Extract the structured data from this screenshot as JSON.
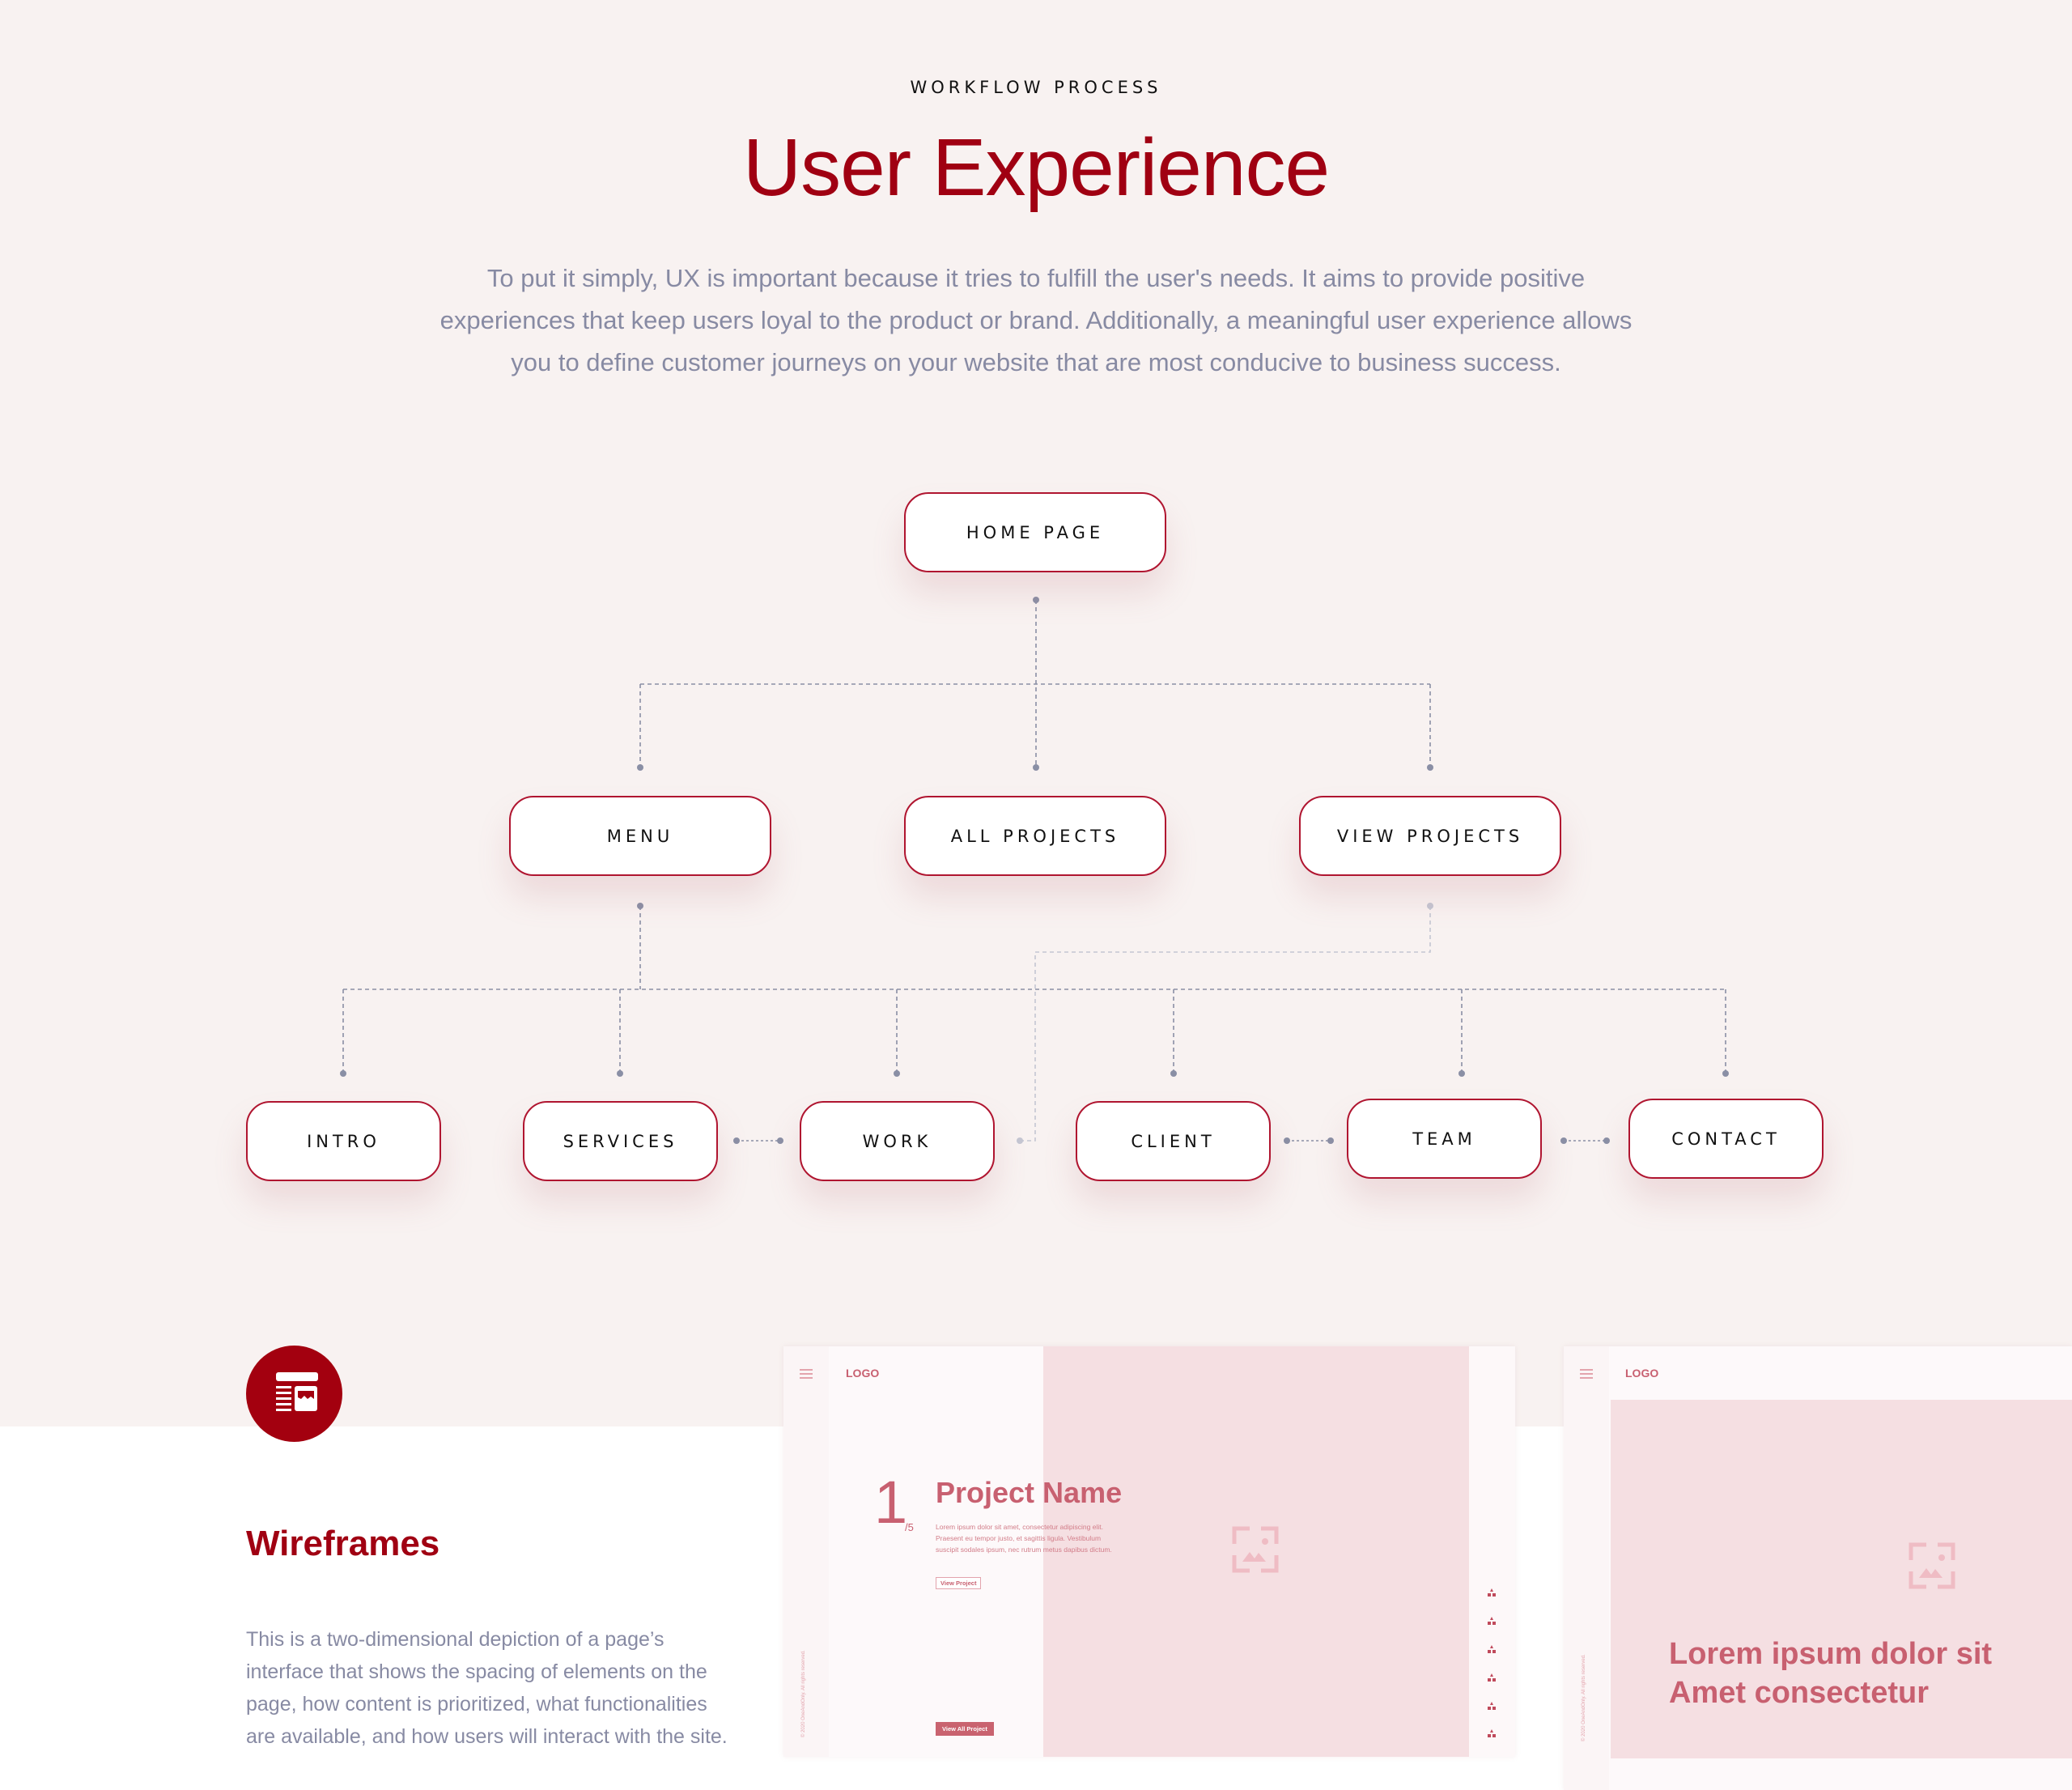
{
  "header": {
    "eyebrow": "WORKFLOW PROCESS",
    "title": "User Experience",
    "intro": "To put it simply, UX is important because it tries to fulfill the user's needs. It aims to provide positive experiences that keep users loyal to the product or brand. Additionally, a meaningful user experience allows you to define customer journeys on your website that are most conducive to business success."
  },
  "flowchart": {
    "root": {
      "label": "HOME PAGE"
    },
    "level1": [
      {
        "label": "MENU"
      },
      {
        "label": "ALL PROJECTS"
      },
      {
        "label": "VIEW PROJECTS"
      }
    ],
    "level2": [
      {
        "label": "INTRO"
      },
      {
        "label": "SERVICES"
      },
      {
        "label": "WORK"
      },
      {
        "label": "CLIENT"
      },
      {
        "label": "TEAM"
      },
      {
        "label": "CONTACT"
      }
    ],
    "edges": [
      [
        "HOME PAGE",
        "MENU"
      ],
      [
        "HOME PAGE",
        "ALL PROJECTS"
      ],
      [
        "HOME PAGE",
        "VIEW PROJECTS"
      ],
      [
        "MENU",
        "INTRO"
      ],
      [
        "MENU",
        "SERVICES"
      ],
      [
        "MENU",
        "WORK"
      ],
      [
        "MENU",
        "CLIENT"
      ],
      [
        "MENU",
        "TEAM"
      ],
      [
        "MENU",
        "CONTACT"
      ],
      [
        "VIEW PROJECTS",
        "WORK"
      ],
      [
        "SERVICES",
        "WORK"
      ],
      [
        "CLIENT",
        "TEAM"
      ],
      [
        "TEAM",
        "CONTACT"
      ]
    ],
    "colors": {
      "border": "#b01530",
      "connector": "#8a8fa5"
    }
  },
  "feature": {
    "icon": "wireframe-layout-icon",
    "title": "Wireframes",
    "description": "This is a two-dimensional depiction of a page’s interface that shows the spacing of elements on the page, how content is prioritized, what functionalities are available, and how users will interact with the site."
  },
  "wireframe1": {
    "logo": "LOGO",
    "slide_number": "1",
    "slide_total": "/5",
    "project_name": "Project Name",
    "lorem": "Lorem ipsum dolor sit amet, consectetur adipiscing elit. Praesent eu tempor justo, et sagittis ligula. Vestibulum suscipit sodales ipsum, nec rutrum metus dapibus dictum.",
    "view_project": "View Project",
    "view_all": "View All Project",
    "copyright": "© 2020 OneAndOnly. All rights reserved.",
    "side_icon_count": 6
  },
  "wireframe2": {
    "logo": "LOGO",
    "headline_line1": "Lorem ipsum dolor sit",
    "headline_line2": "Amet consectetur",
    "copyright": "© 2020 OneAndOnly. All rights reserved."
  },
  "colors": {
    "accent": "#a00012",
    "background_top": "#f8f2f1",
    "muted_text": "#878aa3",
    "wireframe_pink": "#f5dfe2",
    "wireframe_text": "#c86070"
  }
}
